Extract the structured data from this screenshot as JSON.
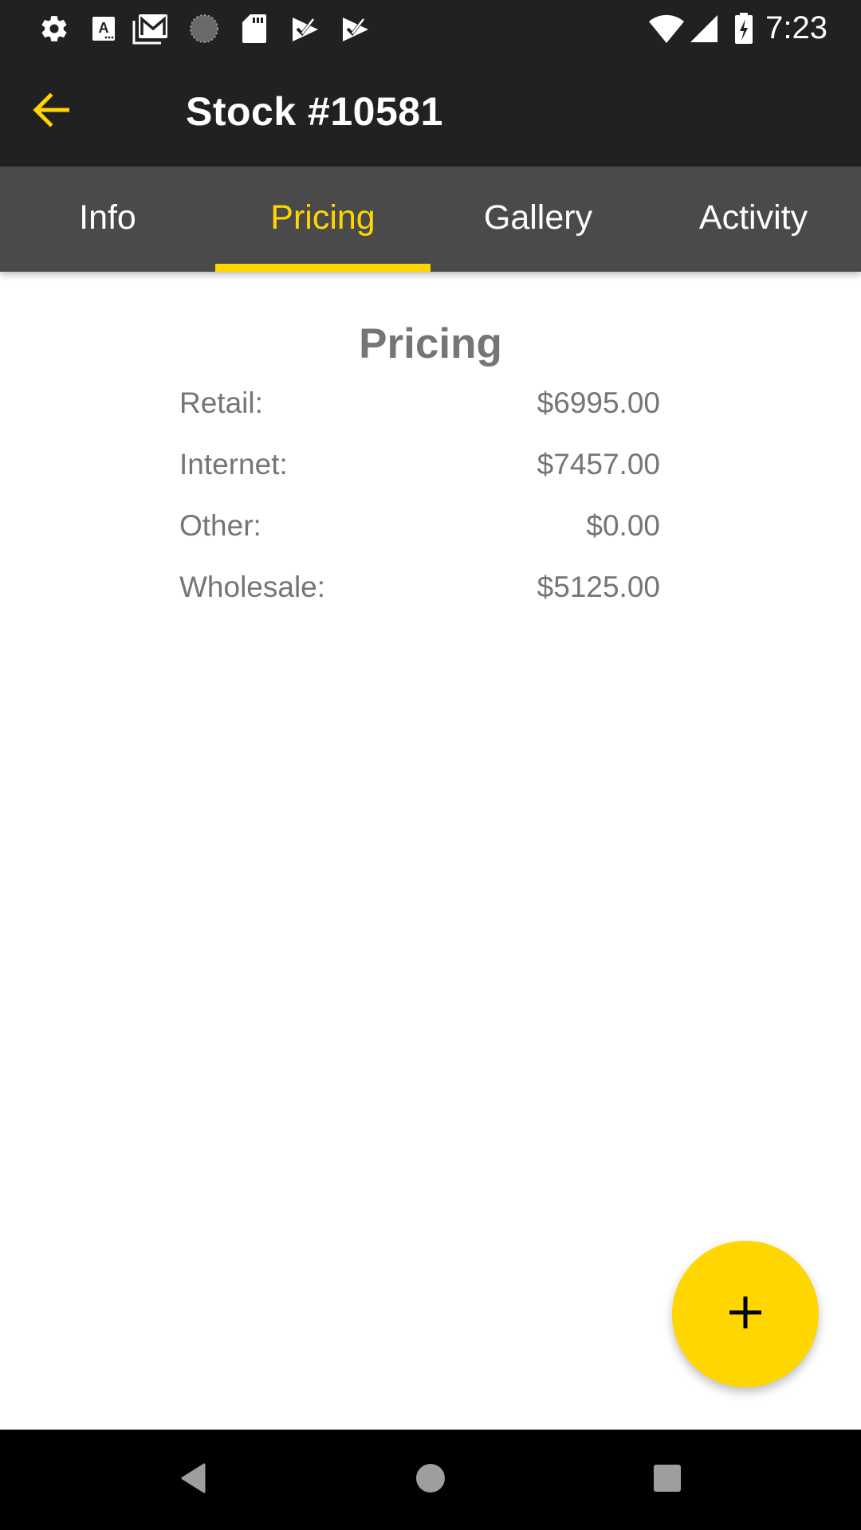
{
  "status_bar": {
    "left_icons": [
      "gear-icon",
      "keyboard-a-icon",
      "gmail-icon",
      "sync-spinner-icon",
      "sd-card-icon",
      "play-check-icon",
      "play-check-icon"
    ],
    "right_icons": [
      "wifi-icon",
      "cell-signal-icon",
      "battery-charging-icon"
    ],
    "time": "7:23"
  },
  "toolbar": {
    "title": "Stock #10581",
    "back_icon": "arrow-left-icon"
  },
  "tabs": [
    {
      "label": "Info",
      "active": false
    },
    {
      "label": "Pricing",
      "active": true
    },
    {
      "label": "Gallery",
      "active": false
    },
    {
      "label": "Activity",
      "active": false
    }
  ],
  "pricing": {
    "title": "Pricing",
    "rows": [
      {
        "label": "Retail:",
        "value": "$6995.00"
      },
      {
        "label": "Internet:",
        "value": "$7457.00"
      },
      {
        "label": "Other:",
        "value": "$0.00"
      },
      {
        "label": "Wholesale:",
        "value": "$5125.00"
      }
    ]
  },
  "fab": {
    "icon": "plus-icon"
  },
  "nav_bar": {
    "buttons": [
      "back-triangle-icon",
      "home-circle-icon",
      "recents-square-icon"
    ]
  },
  "colors": {
    "accent": "#ffd600",
    "toolbar": "#212121",
    "tab_bar": "#4a4a4a",
    "text_gray": "#757575"
  }
}
